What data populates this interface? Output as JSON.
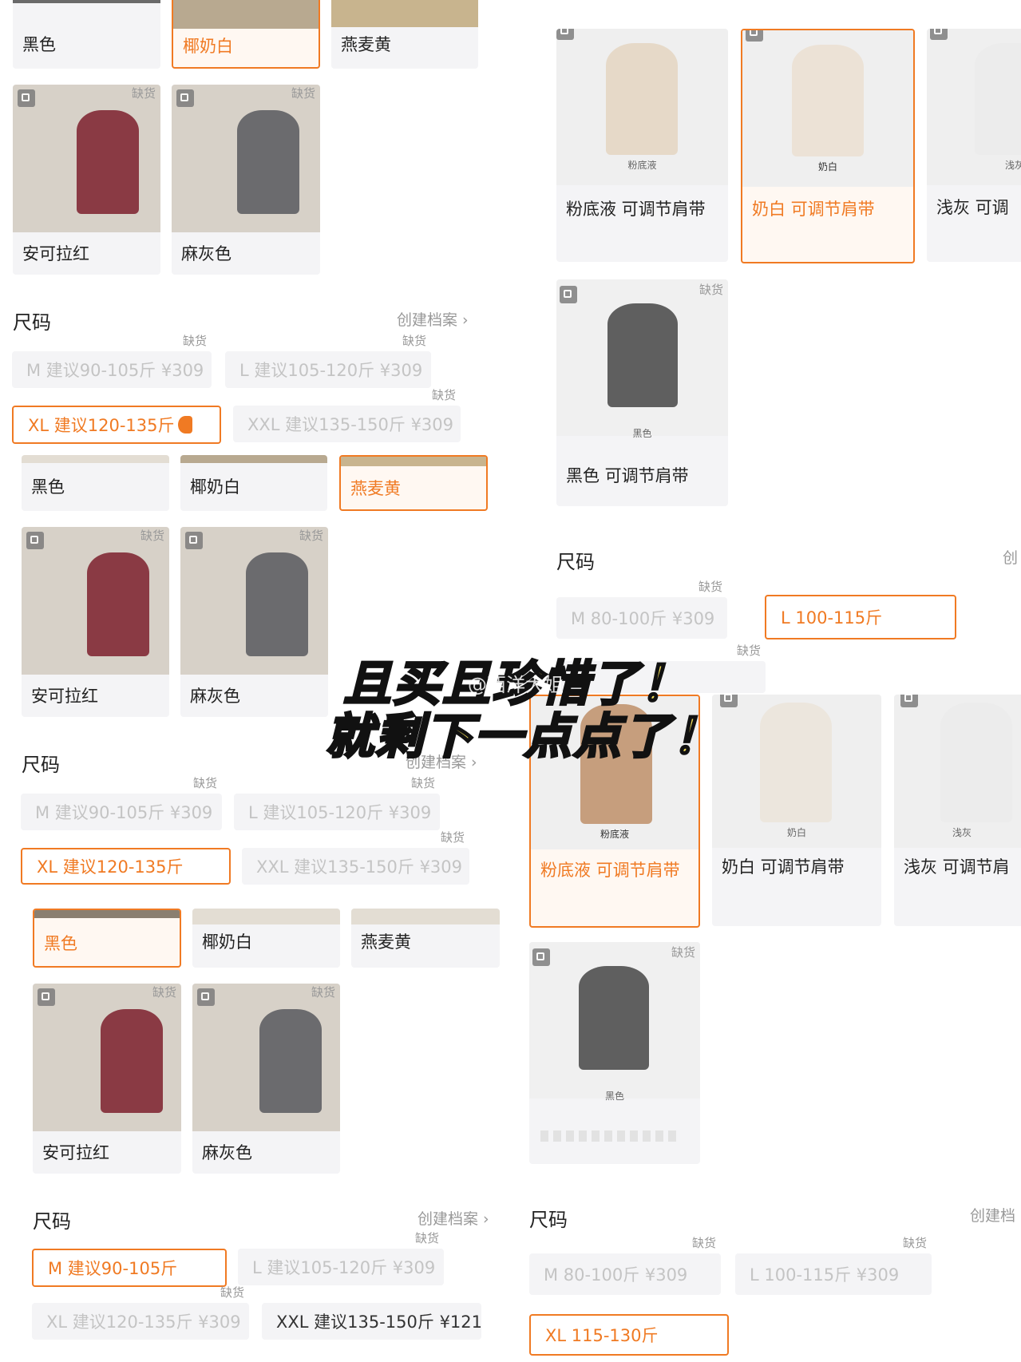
{
  "colors": {
    "accent": "#f07a23",
    "muted": "#c4c4c4",
    "tile": "#f4f4f6"
  },
  "left": {
    "block1": {
      "colors": [
        "黑色",
        "椰奶白",
        "燕麦黄"
      ],
      "products": [
        {
          "label": "安可拉红",
          "tag": "缺货"
        },
        {
          "label": "麻灰色",
          "tag": "缺货"
        }
      ],
      "size_title": "尺码",
      "size_link": "创建档案 ›",
      "sizes": [
        {
          "label": "M 建议90-105斤 ¥309",
          "tag": "缺货"
        },
        {
          "label": "L 建议105-120斤 ¥309",
          "tag": "缺货"
        },
        {
          "label": "XL 建议120-135斤",
          "tag": ""
        },
        {
          "label": "XXL 建议135-150斤 ¥309",
          "tag": "缺货"
        }
      ]
    },
    "block2": {
      "colors": [
        "黑色",
        "椰奶白",
        "燕麦黄"
      ],
      "products": [
        {
          "label": "安可拉红",
          "tag": "缺货"
        },
        {
          "label": "麻灰色",
          "tag": "缺货"
        }
      ],
      "size_title": "尺码",
      "size_link": "创建档案 ›",
      "sizes": [
        {
          "label": "M 建议90-105斤 ¥309",
          "tag": "缺货"
        },
        {
          "label": "L 建议105-120斤 ¥309",
          "tag": "缺货"
        },
        {
          "label": "XL 建议120-135斤",
          "tag": ""
        },
        {
          "label": "XXL 建议135-150斤 ¥309",
          "tag": "缺货"
        }
      ]
    },
    "block3": {
      "colors": [
        "黑色",
        "椰奶白",
        "燕麦黄"
      ],
      "products": [
        {
          "label": "安可拉红",
          "tag": "缺货"
        },
        {
          "label": "麻灰色",
          "tag": "缺货"
        }
      ],
      "size_title": "尺码",
      "size_link": "创建档案 ›",
      "sizes": [
        {
          "label": "M 建议90-105斤",
          "tag": ""
        },
        {
          "label": "L 建议105-120斤 ¥309",
          "tag": "缺货"
        },
        {
          "label": "XL 建议120-135斤 ¥309",
          "tag": "缺货"
        },
        {
          "label": "XXL 建议135-150斤 ¥121",
          "tag": ""
        }
      ]
    }
  },
  "right": {
    "block1": {
      "products": [
        {
          "label": "粉底液 可调节肩带",
          "caption": "粉底液"
        },
        {
          "label": "奶白 可调节肩带",
          "caption": "奶白"
        },
        {
          "label": "浅灰 可调",
          "caption": "浅灰"
        },
        {
          "label": "黑色 可调节肩带",
          "caption": "黑色",
          "tag": "缺货"
        }
      ],
      "size_title": "尺码",
      "size_link": "创",
      "sizes": [
        {
          "label": "M 80-100斤 ¥309",
          "tag": "缺货"
        },
        {
          "label": "L 100-115斤",
          "tag": ""
        },
        {
          "label": "",
          "tag": "缺货"
        }
      ]
    },
    "block2": {
      "products": [
        {
          "label": "粉底液 可调节肩带",
          "caption": "粉底液"
        },
        {
          "label": "奶白 可调节肩带",
          "caption": "奶白"
        },
        {
          "label": "浅灰 可调节肩",
          "caption": "浅灰"
        },
        {
          "label": "",
          "caption": "黑色",
          "tag": "缺货"
        }
      ],
      "size_title": "尺码",
      "size_link": "创建档",
      "sizes": [
        {
          "label": "M 80-100斤 ¥309",
          "tag": "缺货"
        },
        {
          "label": "L 100-115斤 ¥309",
          "tag": "缺货"
        },
        {
          "label": "XL 115-130斤",
          "tag": ""
        }
      ]
    }
  },
  "overlay": {
    "line1": "且买且珍惜了！",
    "line2": "就剩下一点点了！",
    "watermark": "@西洋大姐"
  }
}
